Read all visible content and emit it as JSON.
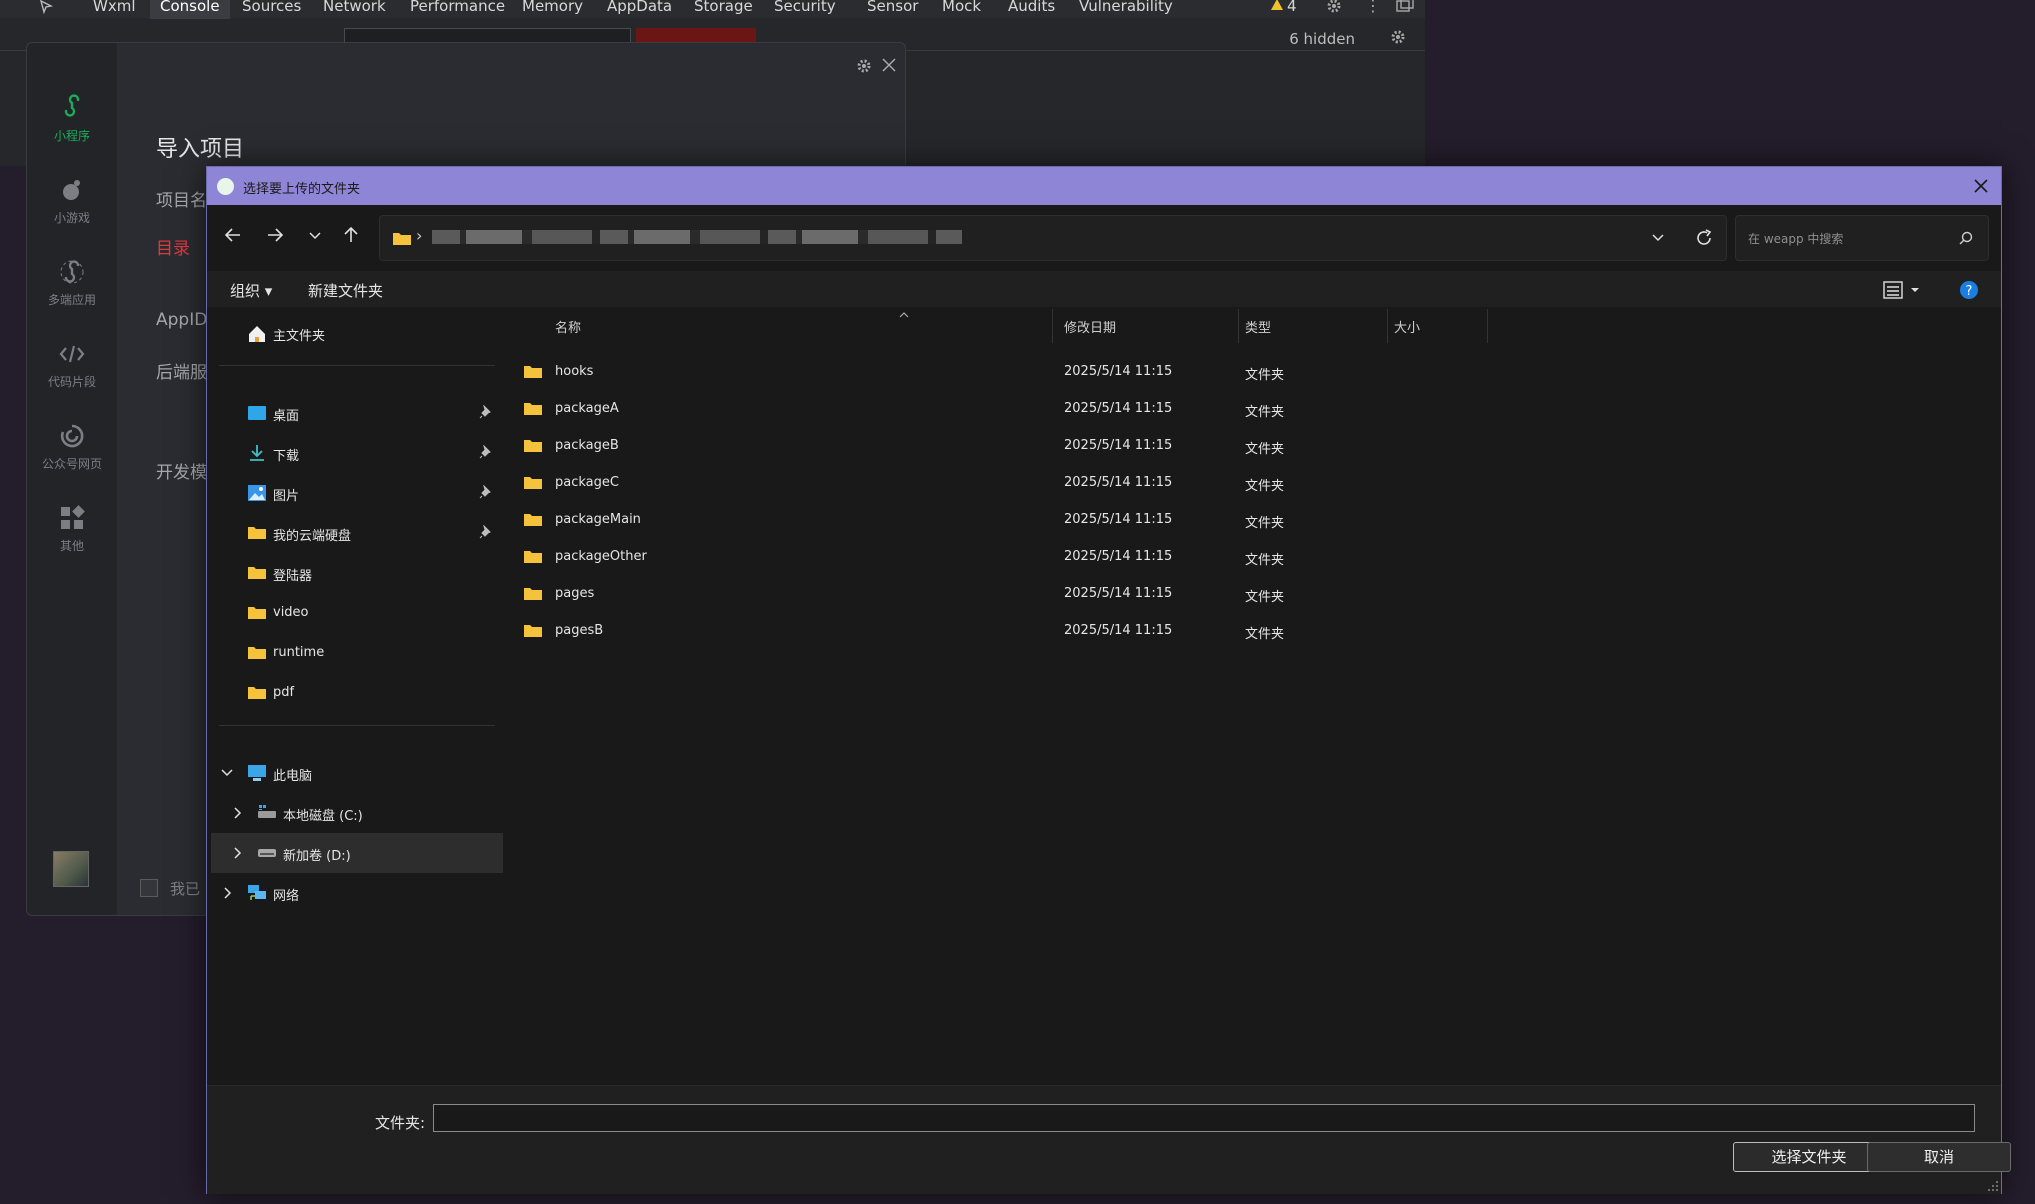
{
  "devtools": {
    "tabs": [
      "Wxml",
      "Console",
      "Sources",
      "Network",
      "Performance",
      "Memory",
      "AppData",
      "Storage",
      "Security",
      "Sensor",
      "Mock",
      "Audits",
      "Vulnerability"
    ],
    "active_tab": "Console",
    "warning_count": "4",
    "hidden_count": "6 hidden"
  },
  "ide": {
    "sidebar": [
      {
        "label": "小程序",
        "icon": "miniprogram-icon"
      },
      {
        "label": "小游戏",
        "icon": "minigame-icon"
      },
      {
        "label": "多端应用",
        "icon": "multiplatform-icon"
      },
      {
        "label": "代码片段",
        "icon": "code-snippet-icon"
      },
      {
        "label": "公众号网页",
        "icon": "official-account-icon"
      },
      {
        "label": "其他",
        "icon": "other-icon"
      }
    ],
    "title": "导入项目",
    "labels": {
      "project_name": "项目名",
      "directory": "目录",
      "appid": "AppID",
      "backend": "后端服",
      "dev_mode": "开发模"
    },
    "agree": "我已"
  },
  "dialog": {
    "title": "选择要上传的文件夹",
    "search_placeholder": "在 weapp 中搜索",
    "cmd": {
      "organize": "组织 ▾",
      "new_folder": "新建文件夹"
    },
    "nav": {
      "home": "主文件夹",
      "quick": [
        {
          "label": "桌面",
          "icon": "desktop-icon",
          "pinned": true
        },
        {
          "label": "下载",
          "icon": "download-icon",
          "pinned": true
        },
        {
          "label": "图片",
          "icon": "pictures-icon",
          "pinned": true
        },
        {
          "label": "我的云端硬盘",
          "icon": "folder-icon",
          "pinned": true
        },
        {
          "label": "登陆器",
          "icon": "folder-icon",
          "pinned": false
        },
        {
          "label": "video",
          "icon": "folder-icon",
          "pinned": false
        },
        {
          "label": "runtime",
          "icon": "folder-icon",
          "pinned": false
        },
        {
          "label": "pdf",
          "icon": "folder-icon",
          "pinned": false
        }
      ],
      "this_pc": "此电脑",
      "drive_c": "本地磁盘 (C:)",
      "drive_d": "新加卷 (D:)",
      "network": "网络"
    },
    "columns": {
      "name": "名称",
      "modified": "修改日期",
      "type": "类型",
      "size": "大小"
    },
    "files": [
      {
        "name": "hooks",
        "modified": "2025/5/14 11:15",
        "type": "文件夹"
      },
      {
        "name": "packageA",
        "modified": "2025/5/14 11:15",
        "type": "文件夹"
      },
      {
        "name": "packageB",
        "modified": "2025/5/14 11:15",
        "type": "文件夹"
      },
      {
        "name": "packageC",
        "modified": "2025/5/14 11:15",
        "type": "文件夹"
      },
      {
        "name": "packageMain",
        "modified": "2025/5/14 11:15",
        "type": "文件夹"
      },
      {
        "name": "packageOther",
        "modified": "2025/5/14 11:15",
        "type": "文件夹"
      },
      {
        "name": "pages",
        "modified": "2025/5/14 11:15",
        "type": "文件夹"
      },
      {
        "name": "pagesB",
        "modified": "2025/5/14 11:15",
        "type": "文件夹"
      }
    ],
    "footer": {
      "folder_label": "文件夹:",
      "folder_value": "",
      "select_button": "选择文件夹",
      "cancel_button": "取消"
    }
  },
  "colors": {
    "titlebar": "#8e85d6",
    "folder": "#f5c33b",
    "accent_green": "#1aad5a",
    "error_red": "#e0393e",
    "help_blue": "#1a7fe0"
  }
}
